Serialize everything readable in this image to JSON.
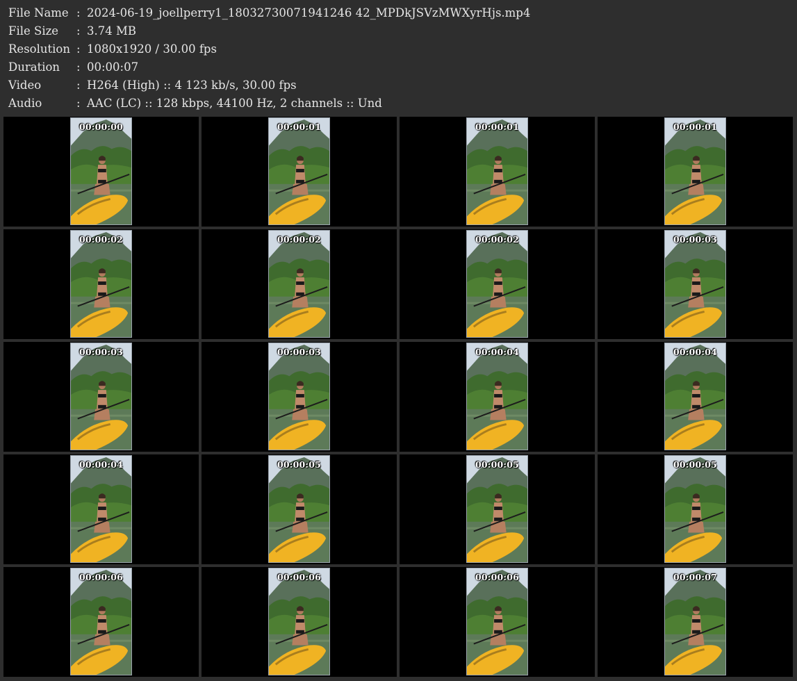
{
  "info": [
    {
      "label": "File Name",
      "sep": ":",
      "value": "2024-06-19_joellperry1_18032730071941246 42_MPDkJSVzMWXyrHjs.mp4"
    },
    {
      "label": "File Size",
      "sep": ":",
      "value": "3.74 MB"
    },
    {
      "label": "Resolution",
      "sep": ":",
      "value": "1080x1920 / 30.00 fps"
    },
    {
      "label": "Duration",
      "sep": ":",
      "value": "00:00:07"
    },
    {
      "label": "Video",
      "sep": ":",
      "value": "H264 (High) :: 4 123 kb/s, 30.00 fps"
    },
    {
      "label": "Audio",
      "sep": ":",
      "value": "AAC (LC) :: 128 kbps, 44100 Hz, 2 channels :: Und"
    }
  ],
  "timestamps": [
    "00:00:00",
    "00:00:01",
    "00:00:01",
    "00:00:01",
    "00:00:02",
    "00:00:02",
    "00:00:02",
    "00:00:03",
    "00:00:03",
    "00:00:03",
    "00:00:04",
    "00:00:04",
    "00:00:04",
    "00:00:05",
    "00:00:05",
    "00:00:05",
    "00:00:06",
    "00:00:06",
    "00:00:06",
    "00:00:07"
  ],
  "colors": {
    "background": "#2e2e2e",
    "cell": "#000000",
    "text": "#e6e6e6",
    "board": "#f0b323",
    "water": "#5d7a58"
  }
}
